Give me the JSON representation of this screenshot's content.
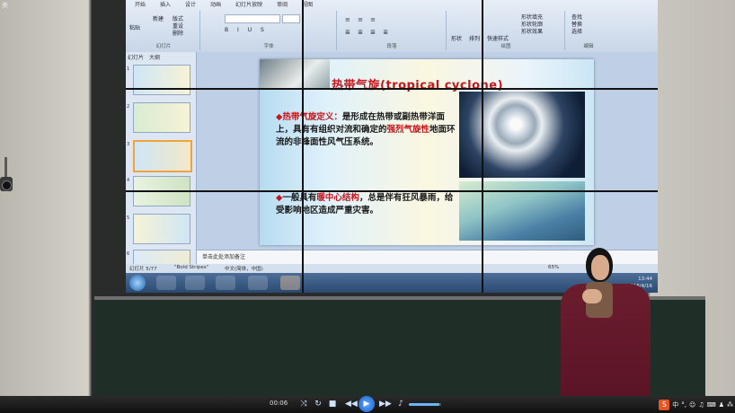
{
  "window": {
    "title": "美"
  },
  "ribbon": {
    "tabs": [
      "开始",
      "插入",
      "设计",
      "动画",
      "幻灯片放映",
      "审阅",
      "视图"
    ],
    "groups": [
      "幻灯片",
      "字体",
      "段落",
      "绘图",
      "编辑"
    ],
    "buttons": [
      "粘贴",
      "新建",
      "版式",
      "重设",
      "删除",
      "形状",
      "排列",
      "快速样式",
      "形状填充",
      "形状轮廓",
      "形状效果",
      "查找",
      "替换",
      "选择"
    ]
  },
  "slide_panel": {
    "tabs": [
      "幻灯片",
      "大纲"
    ],
    "numbers": [
      "1",
      "2",
      "3",
      "4",
      "5",
      "6"
    ]
  },
  "slide": {
    "title": "热带气旋(tropical cyclone)",
    "bullet1_head": "热带气旋定义：",
    "bullet1_body": "是形成在热带或副热带洋面上，具有有组织对流和确定的",
    "bullet1_red": "强烈气旋性",
    "bullet1_tail": "地面环流的非锋面性风气压系统。",
    "bullet2_head": "一般具有",
    "bullet2_red": "暖中心结构",
    "bullet2_tail": "，总是伴有狂风暴雨，给受影响地区造成严重灾害。",
    "bullet_mark": "◆"
  },
  "notes": {
    "placeholder": "单击此处添加备注"
  },
  "statusbar": {
    "slide_info": "幻灯片 5/77",
    "theme": "\"Bold Stripes\"",
    "language": "中文(简体，中国)",
    "zoom": "65%"
  },
  "taskbar": {
    "time": "13:44",
    "date": "2016/4/16"
  },
  "player": {
    "time": "00:06",
    "volume_fraction": 0.95,
    "ime_label": "中",
    "ime_logo": "S"
  },
  "colors": {
    "title_red": "#c4161c",
    "ribbon": "#dfe8f3",
    "player_accent": "#1a5ec7"
  }
}
